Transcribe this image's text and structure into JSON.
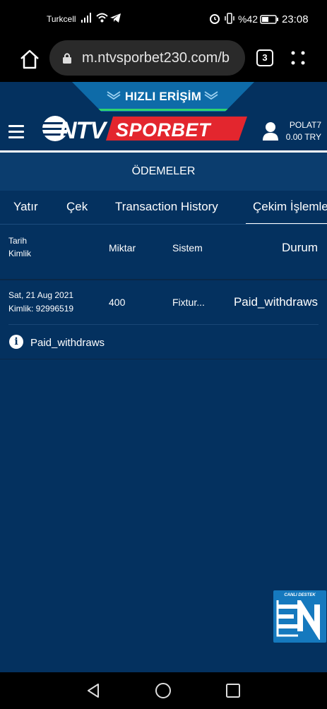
{
  "status_bar": {
    "carrier": "Turkcell",
    "battery_percent": "%42",
    "time": "23:08",
    "icons": [
      "signal-icon",
      "wifi-icon",
      "telegram-icon",
      "alarm-icon",
      "vibrate-icon",
      "battery-icon"
    ]
  },
  "browser": {
    "url": "m.ntvsporbet230.com/b",
    "tab_count": "3",
    "icons": [
      "home-icon",
      "lock-icon",
      "menu-dots-icon"
    ]
  },
  "header": {
    "quick_access_label": "HIZLI ERİŞİM",
    "logo_alt": "NTV SPORBET",
    "username": "POLAT7",
    "balance": "0.00 TRY",
    "colors": {
      "background": "#04315f",
      "quick_access": "#0e6ba8",
      "logo_red": "#e3262e",
      "green": "#2fd46e"
    }
  },
  "page": {
    "section_title": "ÖDEMELER",
    "tabs": [
      {
        "label": "Yatır",
        "active": false
      },
      {
        "label": "Çek",
        "active": false
      },
      {
        "label": "Transaction History",
        "active": false
      },
      {
        "label": "Çekim İşlemleri",
        "active": true
      }
    ]
  },
  "table": {
    "headers": {
      "date": "Tarih",
      "id": "Kimlik",
      "amount": "Miktar",
      "system": "Sistem",
      "status": "Durum"
    },
    "rows": [
      {
        "date": "Sat, 21 Aug 2021",
        "id": "Kimlik: 92996519",
        "amount": "400",
        "system": "Fixtur...",
        "status": "Paid_withdraws"
      }
    ],
    "info_text": "Paid_withdraws"
  },
  "live_support": {
    "label": "CANLI DESTEK"
  },
  "nav_bar": {
    "icons": [
      "back-icon",
      "home-circle-icon",
      "recents-icon"
    ]
  }
}
